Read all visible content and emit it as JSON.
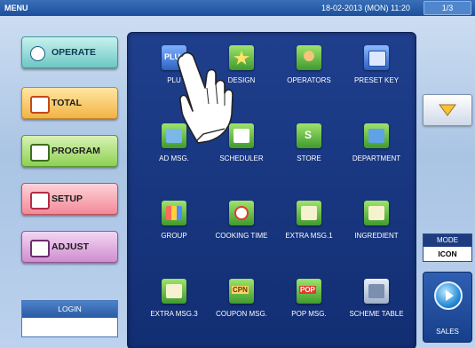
{
  "topbar": {
    "menu": "MENU",
    "datetime": "18-02-2013 (MON) 11:20",
    "page": "1/3"
  },
  "nav": [
    {
      "name": "operate",
      "label": "OPERATE"
    },
    {
      "name": "total",
      "label": "TOTAL"
    },
    {
      "name": "program",
      "label": "PROGRAM"
    },
    {
      "name": "setup",
      "label": "SETUP"
    },
    {
      "name": "adjust",
      "label": "ADJUST"
    }
  ],
  "login": {
    "label": "LOGIN"
  },
  "tiles": [
    {
      "label": "PLU",
      "icon": "plu-icon"
    },
    {
      "label": "DESIGN",
      "icon": "design-star-icon"
    },
    {
      "label": "OPERATORS",
      "icon": "operators-icon"
    },
    {
      "label": "PRESET KEY",
      "icon": "preset-key-icon"
    },
    {
      "label": "AD MSG.",
      "icon": "ad-msg-icon"
    },
    {
      "label": "SCHEDULER",
      "icon": "scheduler-icon"
    },
    {
      "label": "STORE",
      "icon": "store-icon"
    },
    {
      "label": "DEPARTMENT",
      "icon": "department-folder-icon"
    },
    {
      "label": "GROUP",
      "icon": "group-icon"
    },
    {
      "label": "COOKING TIME",
      "icon": "cooking-time-clock-icon"
    },
    {
      "label": "EXTRA MSG.1",
      "icon": "extra-msg-icon"
    },
    {
      "label": "INGREDIENT",
      "icon": "ingredient-icon"
    },
    {
      "label": "EXTRA MSG.3",
      "icon": "extra-msg-icon"
    },
    {
      "label": "COUPON MSG.",
      "icon": "coupon-icon"
    },
    {
      "label": "POP MSG.",
      "icon": "pop-icon"
    },
    {
      "label": "SCHEME TABLE",
      "icon": "scheme-table-icon"
    }
  ],
  "right": {
    "mode_title": "MODE",
    "mode_value": "ICON",
    "sales": "SALES",
    "down_icon": "triangle-down-icon"
  }
}
